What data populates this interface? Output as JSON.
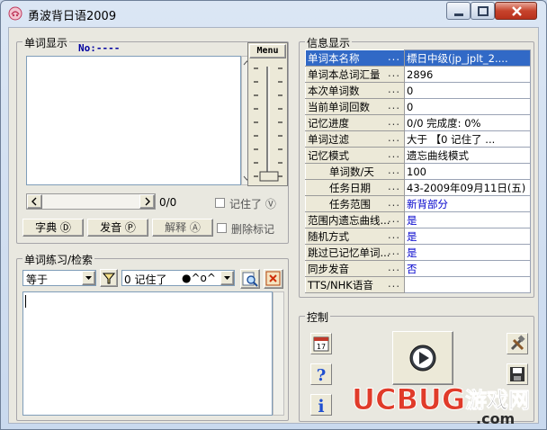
{
  "window": {
    "title": "勇波背日语2009",
    "accent": "#3169c6"
  },
  "word_display": {
    "group_title": "单词显示",
    "no_label": "No:----",
    "menu_label": "Menu",
    "progress_text": "0/0",
    "remembered_label": "记住了",
    "remembered_key": "Ⓥ",
    "buttons": {
      "dictionary": "字典",
      "dictionary_key": "Ⓓ",
      "pronounce": "发音",
      "pronounce_key": "Ⓟ",
      "explain": "解释",
      "explain_key": "Ⓐ",
      "delete_mark": "删除标记"
    }
  },
  "practice": {
    "group_title": "单词练习/检索",
    "match_mode": "等于",
    "filter_value": "0 记住了",
    "face": "●^o^"
  },
  "info": {
    "group_title": "信息显示",
    "rows": [
      {
        "key": "单词本名称",
        "value": "標日中级(jp_jplt_2....",
        "selected": true,
        "indent": false,
        "blue": false
      },
      {
        "key": "单词本总词汇量",
        "value": "2896",
        "selected": false,
        "indent": false,
        "blue": false
      },
      {
        "key": "本次单词数",
        "value": "0",
        "selected": false,
        "indent": false,
        "blue": false
      },
      {
        "key": "当前单词回数",
        "value": "0",
        "selected": false,
        "indent": false,
        "blue": false
      },
      {
        "key": "记忆进度",
        "value": "0/0      完成度: 0%",
        "selected": false,
        "indent": false,
        "blue": false
      },
      {
        "key": "单词过滤",
        "value": "大于  【0 记住了   ...",
        "selected": false,
        "indent": false,
        "blue": false
      },
      {
        "key": "记忆模式",
        "value": "遗忘曲线模式",
        "selected": false,
        "indent": false,
        "blue": false
      },
      {
        "key": "单词数/天",
        "value": "100",
        "selected": false,
        "indent": true,
        "blue": false
      },
      {
        "key": "任务日期",
        "value": "43-2009年09月11日(五)",
        "selected": false,
        "indent": true,
        "blue": false
      },
      {
        "key": "任务范围",
        "value": "新背部分",
        "selected": false,
        "indent": true,
        "blue": true
      },
      {
        "key": "范围内遗忘曲线...",
        "value": "是",
        "selected": false,
        "indent": false,
        "blue": true
      },
      {
        "key": "随机方式",
        "value": "是",
        "selected": false,
        "indent": false,
        "blue": true
      },
      {
        "key": "跳过已记忆单词...",
        "value": "是",
        "selected": false,
        "indent": false,
        "blue": true
      },
      {
        "key": "同步发音",
        "value": "否",
        "selected": false,
        "indent": false,
        "blue": true
      },
      {
        "key": "TTS/NHK语音",
        "value": "",
        "selected": false,
        "indent": false,
        "blue": false
      }
    ]
  },
  "control": {
    "group_title": "控制",
    "calendar_day": "17",
    "help_glyph": "?",
    "info_glyph": "i"
  },
  "watermark": {
    "brand": "UCBUG",
    "suffix": "游戏网",
    "domain": ".com"
  }
}
